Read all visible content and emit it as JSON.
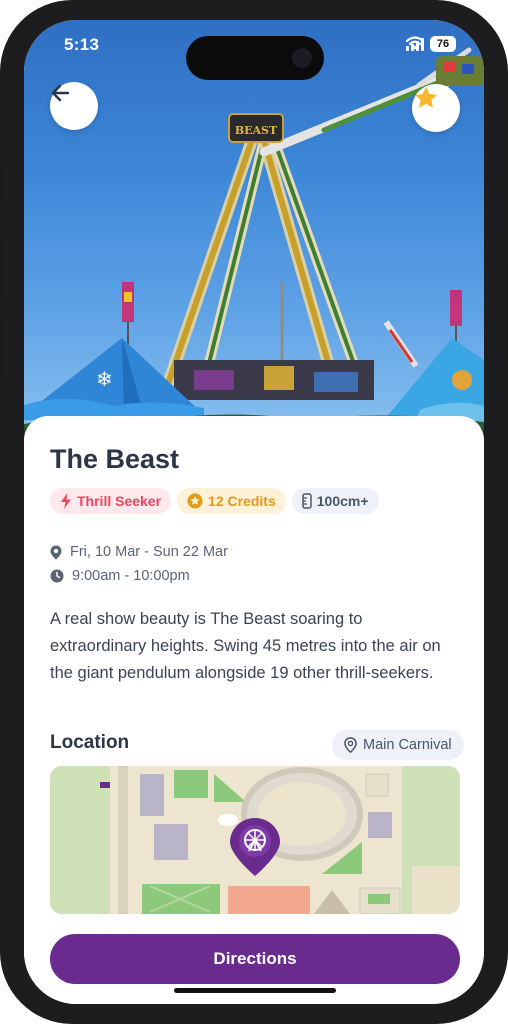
{
  "status_bar": {
    "time": "5:13",
    "battery": "76"
  },
  "hero": {
    "back_icon": "arrow-left-icon",
    "favorite_icon": "star-icon",
    "favorite_color": "#f5b82e"
  },
  "ride": {
    "title": "The Beast",
    "tags": [
      {
        "label": "Thrill Seeker",
        "icon": "lightning-icon",
        "color": "#e8475f"
      },
      {
        "label": "12 Credits",
        "icon": "credit-coin-icon",
        "color": "#e29a17"
      },
      {
        "label": "100cm+",
        "icon": "height-ruler-icon",
        "color": "#4b5568"
      }
    ],
    "dates": "Fri, 10 Mar - Sun 22 Mar",
    "hours": "9:00am - 10:00pm",
    "description": "A real show beauty is The Beast soaring to extraordinary heights. Swing 45 metres into the air on the giant pendulum alongside 19 other thrill-seekers."
  },
  "location": {
    "heading": "Location",
    "area": "Main Carnival",
    "map_pin_icon": "ferris-wheel-pin-icon"
  },
  "actions": {
    "directions_label": "Directions",
    "accent": "#6a2b8e"
  }
}
